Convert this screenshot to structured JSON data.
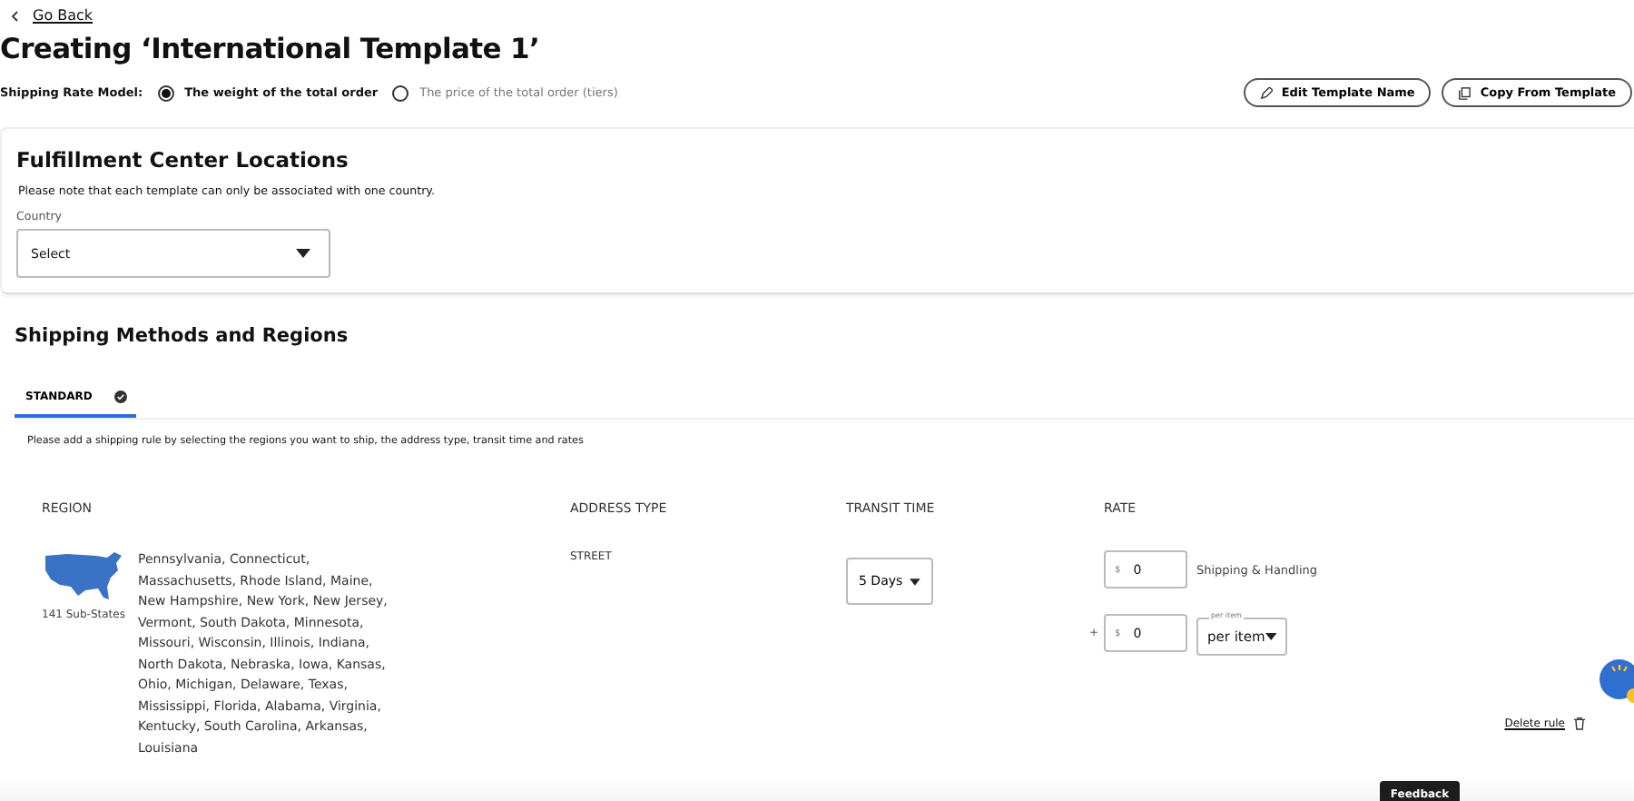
{
  "back_link": {
    "label": "Go Back"
  },
  "title": "Creating ‘International Template 1’",
  "rate_model": {
    "label": "Shipping Rate Model:",
    "options": [
      {
        "label": "The weight of the total order",
        "selected": true
      },
      {
        "label": "The price of the total order (tiers)",
        "selected": false
      }
    ]
  },
  "actions": [
    {
      "kind": "edit",
      "label": "Edit Template Name"
    },
    {
      "kind": "copy",
      "label": "Copy From Template"
    }
  ],
  "fulfillment": {
    "heading": "Fulfillment Center Locations",
    "note": "Please note that each template can only be associated with one country.",
    "country": {
      "label": "Country",
      "value": "Select"
    }
  },
  "shipping": {
    "heading": "Shipping Methods and Regions",
    "tabs": [
      {
        "label": "STANDARD",
        "selected": true,
        "complete": true
      }
    ],
    "hint": "Please add a shipping rule by selecting the regions you want to ship, the address type, transit time and rates",
    "columns": [
      "REGION",
      "ADDRESS TYPE",
      "TRANSIT TIME",
      "RATE"
    ],
    "rule": {
      "region_count": "141 Sub-States",
      "regions": "Pennsylvania, Connecticut, Massachusetts, Rhode Island, Maine, New Hampshire, New York, New Jersey, Vermont, South Dakota, Minnesota, Missouri, Wisconsin, Illinois, Indiana, North Dakota, Nebraska, Iowa, Kansas, Ohio, Michigan, Delaware, Texas, Mississippi, Florida, Alabama, Virginia, Kentucky, South Carolina, Arkansas, Louisiana",
      "address_type": "STREET",
      "transit_time": "5 Days",
      "base_rate": {
        "currency": "$",
        "value": "0",
        "label": "Shipping & Handling"
      },
      "plus": "+",
      "extra_rate": {
        "currency": "$",
        "value": "0"
      },
      "unit": {
        "label": "per item",
        "value": "per item"
      },
      "delete": "Delete rule"
    }
  },
  "feedback": "Feedback"
}
